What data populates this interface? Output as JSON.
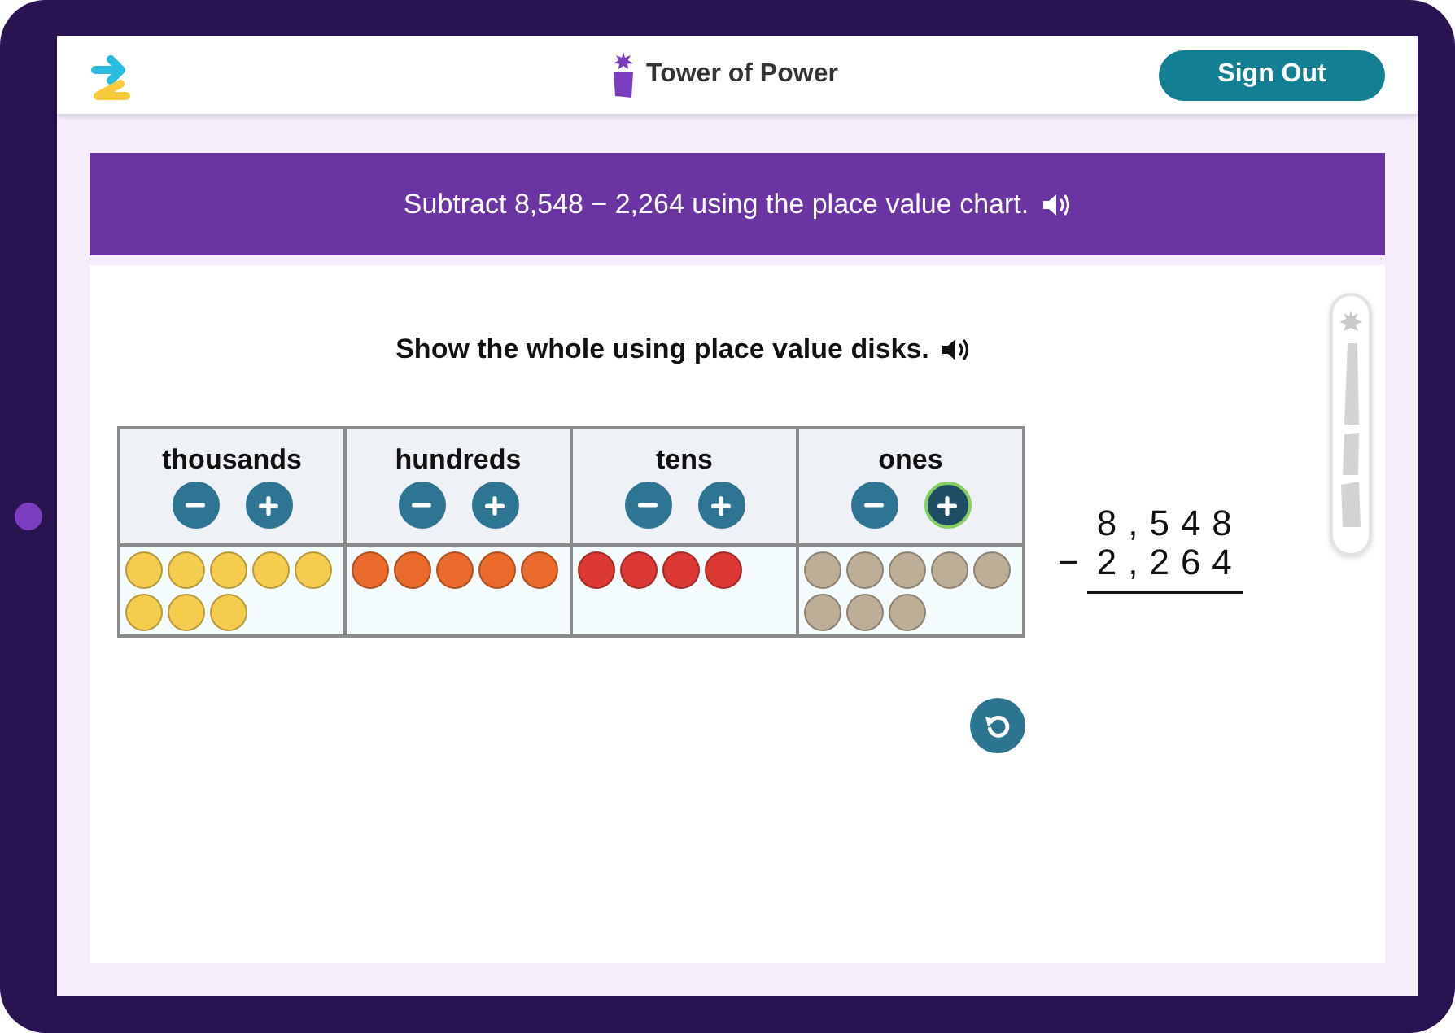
{
  "header": {
    "app_title": "Tower of Power",
    "sign_out_button": "Sign Out"
  },
  "prompt_banner": {
    "text": "Subtract 8,548 − 2,264 using the place value chart."
  },
  "activity": {
    "instruction": "Show the whole using place value disks.",
    "place_value_chart": {
      "columns": [
        {
          "heading": "thousands",
          "buttons": [
            {
              "kind": "minus",
              "highlighted": false
            },
            {
              "kind": "plus",
              "highlighted": false
            }
          ],
          "disks": [
            {
              "color": "#f5cc4d"
            },
            {
              "color": "#f5cc4d"
            },
            {
              "color": "#f5cc4d"
            },
            {
              "color": "#f5cc4d"
            },
            {
              "color": "#f5cc4d"
            },
            {
              "color": "#f5cc4d"
            },
            {
              "color": "#f5cc4d"
            },
            {
              "color": "#f5cc4d"
            }
          ]
        },
        {
          "heading": "hundreds",
          "buttons": [
            {
              "kind": "minus",
              "highlighted": false
            },
            {
              "kind": "plus",
              "highlighted": false
            }
          ],
          "disks": [
            {
              "color": "#e96a2a"
            },
            {
              "color": "#e96a2a"
            },
            {
              "color": "#e96a2a"
            },
            {
              "color": "#e96a2a"
            },
            {
              "color": "#e96a2a"
            }
          ]
        },
        {
          "heading": "tens",
          "buttons": [
            {
              "kind": "minus",
              "highlighted": false
            },
            {
              "kind": "plus",
              "highlighted": false
            }
          ],
          "disks": [
            {
              "color": "#dc3934"
            },
            {
              "color": "#dc3934"
            },
            {
              "color": "#dc3934"
            },
            {
              "color": "#dc3934"
            }
          ]
        },
        {
          "heading": "ones",
          "buttons": [
            {
              "kind": "minus",
              "highlighted": false
            },
            {
              "kind": "plus",
              "highlighted": true
            }
          ],
          "disks": [
            {
              "color": "#bcae97"
            },
            {
              "color": "#bcae97"
            },
            {
              "color": "#bcae97"
            },
            {
              "color": "#bcae97"
            },
            {
              "color": "#bcae97"
            },
            {
              "color": "#bcae97"
            },
            {
              "color": "#bcae97"
            },
            {
              "color": "#bcae97"
            }
          ]
        }
      ]
    },
    "vertical_problem": {
      "minuend": "8,548",
      "operator": "−",
      "subtrahend": "2,264"
    }
  },
  "tower": {
    "star_lit": false,
    "segments": [
      {
        "lit": false
      },
      {
        "lit": false
      },
      {
        "lit": false
      }
    ]
  }
}
